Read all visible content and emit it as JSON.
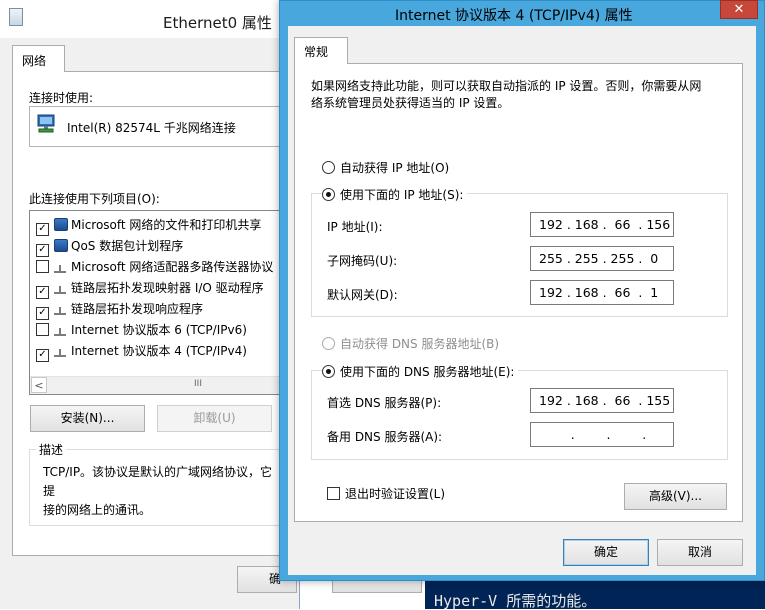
{
  "console": {
    "text": "Hyper-V 所需的功能。"
  },
  "ethernet_window": {
    "title": "Ethernet0 属性",
    "tab": "网络",
    "connect_using_label": "连接时使用:",
    "adapter_name": "Intel(R) 82574L 千兆网络连接",
    "items_label": "此连接使用下列项目(O):",
    "items": [
      {
        "label": "Microsoft 网络的文件和打印机共享",
        "checked": true,
        "icon": "network-client-icon"
      },
      {
        "label": "QoS 数据包计划程序",
        "checked": true,
        "icon": "network-service-icon"
      },
      {
        "label": "Microsoft 网络适配器多路传送器协议",
        "checked": false,
        "icon": "protocol-icon"
      },
      {
        "label": "链路层拓扑发现映射器 I/O 驱动程序",
        "checked": true,
        "icon": "protocol-icon"
      },
      {
        "label": "链路层拓扑发现响应程序",
        "checked": true,
        "icon": "protocol-icon"
      },
      {
        "label": "Internet 协议版本 6 (TCP/IPv6)",
        "checked": false,
        "icon": "protocol-icon"
      },
      {
        "label": "Internet 协议版本 4 (TCP/IPv4)",
        "checked": true,
        "icon": "protocol-icon"
      }
    ],
    "scroll_thumb": "III",
    "scroll_left": "<",
    "install_button": "安装(N)...",
    "uninstall_button": "卸载(U)",
    "description_label": "描述",
    "description_text": "TCP/IP。该协议是默认的广域网络协议，它提接的网络上的通讯。",
    "description_line1": "TCP/IP。该协议是默认的广域网络协议，它提",
    "description_line2": "接的网络上的通讯。",
    "ok_button": "确",
    "cancel_button": ""
  },
  "tcp_dialog": {
    "title": "Internet 协议版本 4 (TCP/IPv4) 属性",
    "close_glyph": "✕",
    "tab": "常规",
    "intro_line1": "如果网络支持此功能，则可以获取自动指派的 IP 设置。否则，你需要从网",
    "intro_line2": "络系统管理员处获得适当的 IP 设置。",
    "auto_ip_option": "自动获得 IP 地址(O)",
    "manual_ip_option": "使用下面的 IP 地址(S):",
    "ip_mode": "manual",
    "ip_label": "IP 地址(I):",
    "ip_value": "192 . 168 .  66  . 156",
    "mask_label": "子网掩码(U):",
    "mask_value": "255 . 255 . 255 .  0",
    "gateway_label": "默认网关(D):",
    "gateway_value": "192 . 168 .  66  .  1",
    "auto_dns_option": "自动获得 DNS 服务器地址(B)",
    "manual_dns_option": "使用下面的 DNS 服务器地址(E):",
    "dns_mode": "manual",
    "preferred_dns_label": "首选 DNS 服务器(P):",
    "preferred_dns_value": "192 . 168 .  66  . 155",
    "alternate_dns_label": "备用 DNS 服务器(A):",
    "alternate_dns_value": "        .        .        .",
    "validate_label": "退出时验证设置(L)",
    "validate_checked": false,
    "advanced_button": "高级(V)...",
    "ok_button": "确定",
    "cancel_button": "取消"
  },
  "colors": {
    "dialog_frame": "#48a7dc",
    "close_button": "#c7473a",
    "console_bg": "#012456"
  }
}
